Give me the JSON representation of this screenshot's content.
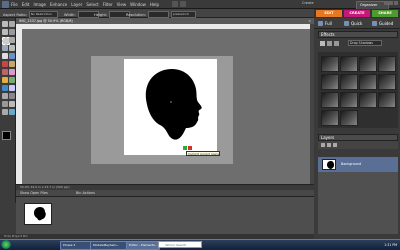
{
  "menubar": {
    "menus": [
      "File",
      "Edit",
      "Image",
      "Enhance",
      "Layer",
      "Select",
      "Filter",
      "View",
      "Window",
      "Help"
    ],
    "create_label": "Create",
    "organizer_label": "Organizer"
  },
  "options": {
    "aspect_label": "Aspect Ratio:",
    "aspect_value": "No Restriction",
    "width_label": "Width:",
    "height_label": "Height:",
    "resolution_label": "Resolution:",
    "resolution_unit": "pixels/inch"
  },
  "mode_tabs": [
    {
      "label": "EDIT",
      "color": "#e87722"
    },
    {
      "label": "CREATE",
      "color": "#c8177a"
    },
    {
      "label": "SHARE",
      "color": "#4e9a2f"
    }
  ],
  "sub_tabs": [
    "Full",
    "Quick",
    "Guided"
  ],
  "document": {
    "tab_title": "IMG_1337.jpg @ 50.9% (RGB/8)",
    "tooltip": "Commit current operation",
    "status": "50.9%   32.0 in x 23.7 in (300 ppi)"
  },
  "bin": {
    "show_open_files": "Show Open Files",
    "bin_actions": "Bin Actions",
    "footer": "Hide Project Bin"
  },
  "panels": {
    "effects_title": "Effects",
    "effects_filter": "Drop Shadows",
    "layers_title": "Layers",
    "layer_name": "Background"
  },
  "taskbar": {
    "items": [
      "Picasa 3",
      "ModelsMayhem...",
      "Editor - Elements..."
    ],
    "search_placeholder": "Yahoo! Search",
    "clock": "1:31 PM"
  }
}
